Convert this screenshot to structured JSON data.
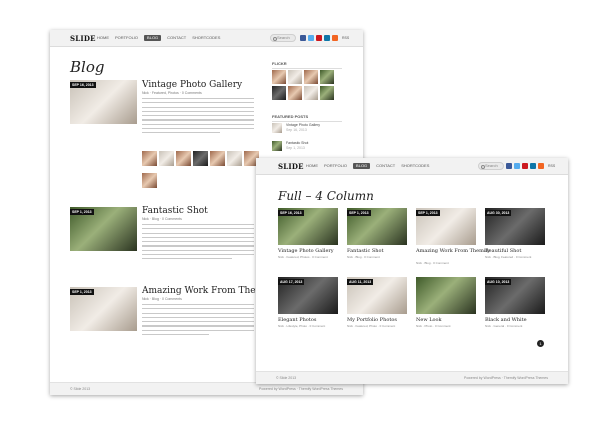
{
  "header": {
    "logo": "SLIDE",
    "nav": [
      "HOME",
      "PORTFOLIO",
      "BLOG",
      "CONTACT",
      "SHORTCODES"
    ],
    "active_nav": "BLOG",
    "search_placeholder": "Search",
    "rss_label": "RSS"
  },
  "blog_page": {
    "title": "Blog",
    "posts": [
      {
        "date": "SEP 16, 2013",
        "title": "Vintage Photo Gallery",
        "meta": "Nick · Featured, Photos · 0 Comments"
      },
      {
        "date": "SEP 1, 2013",
        "title": "Fantastic Shot",
        "meta": "Nick · Blog · 0 Comments"
      },
      {
        "date": "SEP 1, 2013",
        "title": "Amazing Work From Themify",
        "meta": "Nick · Blog · 0 Comments"
      }
    ],
    "sidebar": {
      "flickr_heading": "FLICKR",
      "featured_heading": "FEATURED POSTS",
      "featured_posts": [
        {
          "title": "Vintage Photo Gallery",
          "date": "Sep 16, 2013"
        },
        {
          "title": "Fantastic Shot",
          "date": "Sep 1, 2013"
        }
      ]
    },
    "footer_left": "© Slide 2013",
    "footer_right": "Powered by WordPress · Themify WordPress Themes"
  },
  "column_page": {
    "title": "Full – 4 Column",
    "cards": [
      {
        "date": "SEP 16, 2013",
        "title": "Vintage Photo Gallery",
        "meta": "Nick · Featured, Photos · 0 Comment"
      },
      {
        "date": "SEP 1, 2013",
        "title": "Fantastic Shot",
        "meta": "Nick · Blog · 0 Comment"
      },
      {
        "date": "SEP 1, 2013",
        "title": "Amazing Work From Themify",
        "meta": "Nick · Blog · 0 Comment"
      },
      {
        "date": "AUG 30, 2013",
        "title": "Beautiful Shot",
        "meta": "Nick · Blog, Featured · 0 Comment"
      },
      {
        "date": "AUG 17, 2013",
        "title": "Elegant Photos",
        "meta": "Nick · Lifestyle, Photo · 0 Comment"
      },
      {
        "date": "AUG 11, 2013",
        "title": "My Portfolio Photos",
        "meta": "Nick · Featured, Photo · 0 Comment"
      },
      {
        "date": "",
        "title": "New Look",
        "meta": "Nick · Photo · 0 Comment"
      },
      {
        "date": "AUG 10, 2013",
        "title": "Black and White",
        "meta": "Nick · General · 0 Comment"
      }
    ],
    "pager_label": "1",
    "footer_left": "© Slide 2013",
    "footer_right": "Powered by WordPress · Themify WordPress Themes"
  },
  "colors": {
    "facebook": "#3b5998",
    "twitter": "#55acee",
    "youtube": "#cc181e",
    "linkedin": "#0e76a8",
    "rss": "#f26522"
  }
}
